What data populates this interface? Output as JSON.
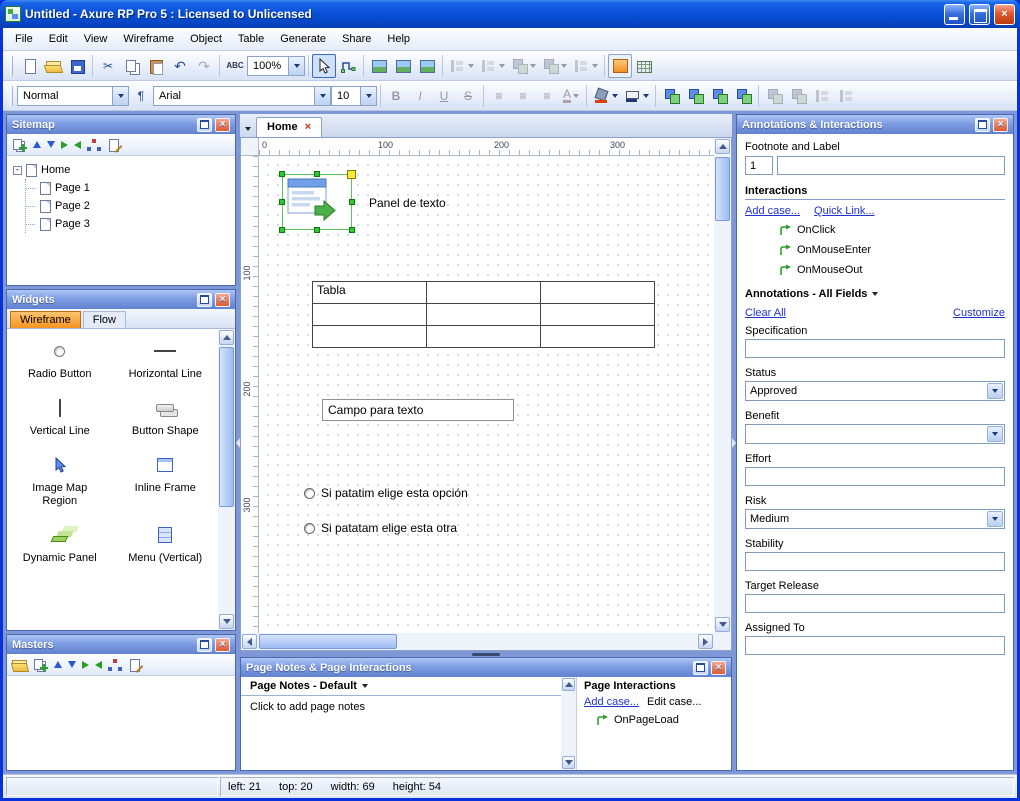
{
  "window": {
    "title": "Untitled - Axure RP Pro 5 : Licensed to Unlicensed"
  },
  "menus": [
    "File",
    "Edit",
    "View",
    "Wireframe",
    "Object",
    "Table",
    "Generate",
    "Share",
    "Help"
  ],
  "toolbar": {
    "zoom": "100%",
    "style": "Normal",
    "font": "Arial",
    "size": "10"
  },
  "icons": {
    "cut": "✂",
    "undo": "↶",
    "redo": "↷",
    "spell": "ABC",
    "close": "×",
    "expander": "-",
    "bold": "B",
    "italic": "I",
    "underline": "U",
    "strike": "S",
    "align": "≡",
    "pilcrow": "¶",
    "font_color": "A"
  },
  "sitemap": {
    "title": "Sitemap",
    "root": "Home",
    "pages": [
      "Page 1",
      "Page 2",
      "Page 3"
    ]
  },
  "widgets": {
    "title": "Widgets",
    "tabs": [
      "Wireframe",
      "Flow"
    ],
    "items": [
      "Radio Button",
      "Horizontal Line",
      "Vertical Line",
      "Button Shape",
      "Image Map Region",
      "Inline Frame",
      "Dynamic Panel",
      "Menu (Vertical)"
    ]
  },
  "masters": {
    "title": "Masters"
  },
  "canvas": {
    "tab": "Home",
    "h_ruler": [
      "0",
      "100",
      "200",
      "300"
    ],
    "v_ruler": [
      "100",
      "200",
      "300"
    ],
    "image_label": "Panel de texto",
    "table_cell": "Tabla",
    "text_field": "Campo para texto",
    "radio1": "Si patatim elige esta opción",
    "radio2": "Si patatam elige esta otra"
  },
  "annotations": {
    "title": "Annotations & Interactions",
    "footnote_label": "Footnote and Label",
    "footnote_value": "1",
    "interactions_heading": "Interactions",
    "add_case": "Add case...",
    "quick_link": "Quick Link...",
    "events": [
      "OnClick",
      "OnMouseEnter",
      "OnMouseOut"
    ],
    "all_fields_heading": "Annotations - All Fields",
    "clear_all": "Clear All",
    "customize": "Customize",
    "fields": {
      "specification": "Specification",
      "status": "Status",
      "benefit": "Benefit",
      "effort": "Effort",
      "risk": "Risk",
      "stability": "Stability",
      "target_release": "Target Release",
      "assigned_to": "Assigned To"
    },
    "values": {
      "status": "Approved",
      "risk": "Medium"
    }
  },
  "page_notes": {
    "title": "Page Notes & Page Interactions",
    "notes_heading": "Page Notes - Default",
    "notes_text": "Click to add page notes",
    "interactions_heading": "Page Interactions",
    "add_case": "Add case...",
    "edit_case": "Edit case...",
    "event": "OnPageLoad"
  },
  "status_bar": {
    "dims": [
      "left: 21",
      "top: 20",
      "width: 69",
      "height: 54"
    ]
  },
  "colors": {
    "accent_orange": "#F79420",
    "selection_green": "#35C435",
    "link_blue": "#2233CC",
    "titlebar_blue": "#0A50D8"
  }
}
